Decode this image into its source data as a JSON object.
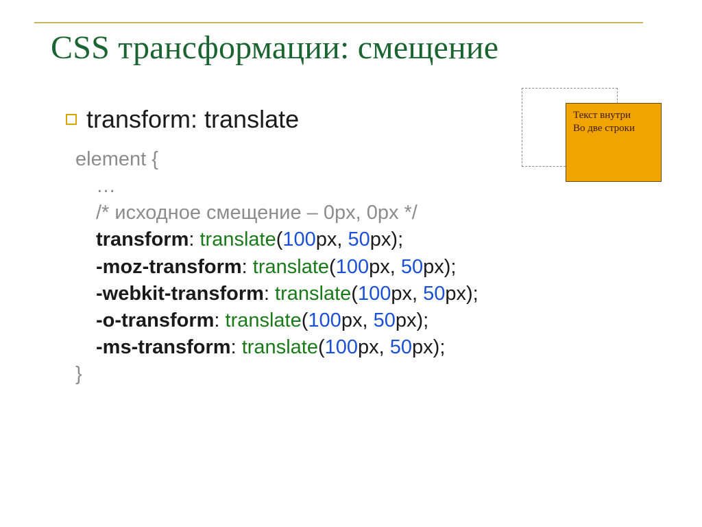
{
  "title": "CSS трансформации: смещение",
  "bullet": "transform: translate",
  "code": {
    "open": "element {",
    "dots": "…",
    "comment": "/* исходное смещение – 0px, 0px */",
    "lines": [
      {
        "prop": "transform",
        "func": "translate",
        "v1": "100",
        "u1": "px, ",
        "v2": "50",
        "u2": "px);"
      },
      {
        "prop": "-moz-transform",
        "func": "translate",
        "v1": "100",
        "u1": "px, ",
        "v2": "50",
        "u2": "px);"
      },
      {
        "prop": "-webkit-transform",
        "func": "translate",
        "v1": "100",
        "u1": "px, ",
        "v2": "50",
        "u2": "px);"
      },
      {
        "prop": "-o-transform",
        "func": "translate",
        "v1": "100",
        "u1": "px, ",
        "v2": "50",
        "u2": "px);"
      },
      {
        "prop": "-ms-transform",
        "func": "translate",
        "v1": "100",
        "u1": "px, ",
        "v2": "50",
        "u2": "px);"
      }
    ],
    "close": "}"
  },
  "example": {
    "line1": "Текст внутри",
    "line2": "Во две строки"
  }
}
